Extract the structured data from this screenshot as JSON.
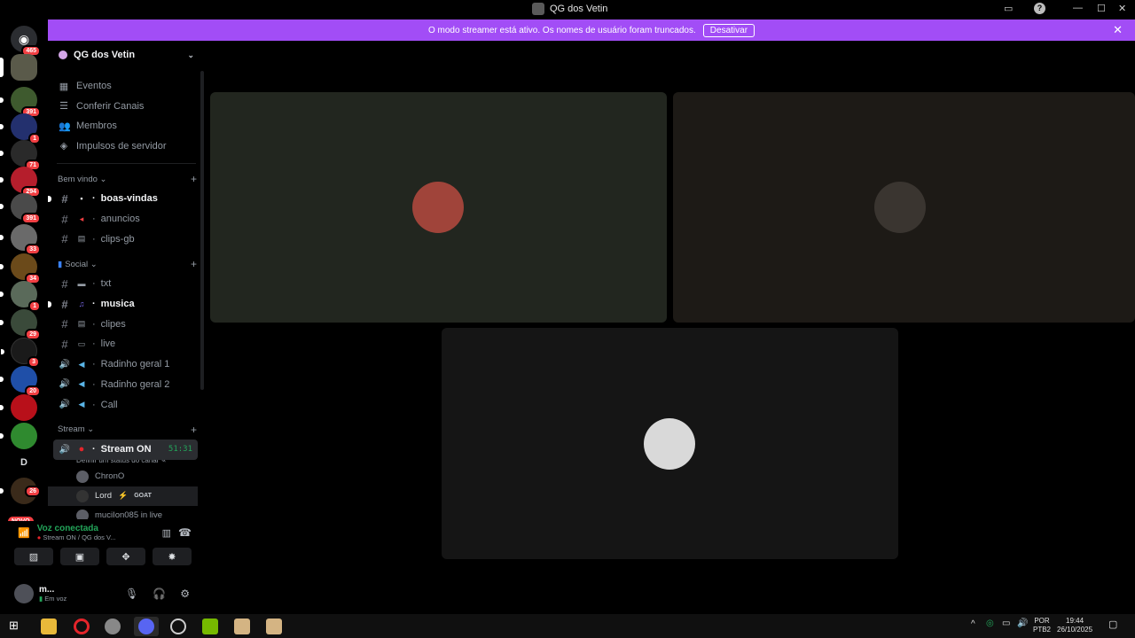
{
  "window": {
    "title": "QG dos Vetin"
  },
  "banner": {
    "message": "O modo streamer está ativo. Os nomes de usuário foram truncados.",
    "action_label": "Desativar"
  },
  "servers": {
    "home_badge": "465",
    "badges": [
      "391",
      "1",
      "71",
      "294",
      "391",
      "33",
      "34",
      "1",
      "29",
      "3",
      "20"
    ],
    "letter_server": "D",
    "last_badge": "26",
    "novo_label": "NOVO"
  },
  "sidebar": {
    "server_name": "QG dos Vetin",
    "nav": [
      {
        "label": "Eventos",
        "icon": "calendar-icon"
      },
      {
        "label": "Conferir Canais",
        "icon": "list-icon"
      },
      {
        "label": "Membros",
        "icon": "members-icon"
      },
      {
        "label": "Impulsos de servidor",
        "icon": "boost-icon"
      }
    ],
    "categories": [
      {
        "name": "Bem vindo",
        "channels": [
          {
            "name": "boas-vindas",
            "type": "text",
            "unread": true
          },
          {
            "name": "anuncios",
            "type": "text",
            "unread": false
          },
          {
            "name": "clips-gb",
            "type": "text",
            "unread": false
          }
        ]
      },
      {
        "name": "Social",
        "channels": [
          {
            "name": "txt",
            "type": "text",
            "unread": false
          },
          {
            "name": "musica",
            "type": "text",
            "unread": true
          },
          {
            "name": "clipes",
            "type": "text",
            "unread": false
          },
          {
            "name": "live",
            "type": "text",
            "unread": false
          },
          {
            "name": "Radinho geral 1",
            "type": "voice",
            "unread": false
          },
          {
            "name": "Radinho geral 2",
            "type": "voice",
            "unread": false
          },
          {
            "name": "Call",
            "type": "voice",
            "unread": false
          }
        ]
      },
      {
        "name": "Stream",
        "channels": [
          {
            "name": "Stream ON",
            "type": "voice",
            "active": true,
            "timer": "51:31",
            "status": "Definir um status do canal"
          }
        ]
      }
    ],
    "voice_members": [
      {
        "name": "ChronO",
        "tag": ""
      },
      {
        "name": "Lord",
        "tag": "GOAT"
      },
      {
        "name": "muciIon085 in live",
        "tag": ""
      }
    ],
    "dot_sep": "·",
    "hash_glyph": "#",
    "voice_glyph": "🔊"
  },
  "voice_panel": {
    "title": "Voz conectada",
    "subtitle": "Stream ON / QG dos V..."
  },
  "user_panel": {
    "name": "m...",
    "status": "Em voz"
  },
  "taskbar": {
    "lang": "POR",
    "layout": "PTB2",
    "time": "19:44",
    "date": "26/10/2025"
  },
  "colors": {
    "banner": "#a24df6",
    "tile1": "#22261f",
    "tile2": "#1d1a16",
    "tile3": "#151515",
    "voice_green": "#23a55a"
  }
}
